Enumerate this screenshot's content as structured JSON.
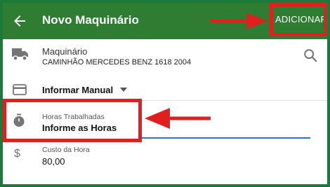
{
  "appbar": {
    "title": "Novo Maquinário",
    "action_label": "ADICIONAR",
    "back_icon": "arrow-back-icon"
  },
  "machine": {
    "label": "Maquinário",
    "value": "CAMINHÃO MERCEDES BENZ 1618 2004",
    "icon": "truck-icon",
    "search_icon": "search-icon"
  },
  "mode": {
    "selected": "Informar Manual",
    "icon": "card-icon",
    "dropdown_icon": "chevron-down-icon"
  },
  "hours": {
    "label": "Horas Trabalhadas",
    "placeholder": "Informe as Horas",
    "icon": "stopwatch-icon"
  },
  "cost": {
    "label": "Custo da Hora",
    "value": "80,00",
    "icon": "dollar-icon"
  },
  "colors": {
    "appbar": "#2e7d32",
    "frame": "#1a7a3c",
    "annotation": "#e11f1f",
    "focus_line": "#2f6fd1"
  }
}
